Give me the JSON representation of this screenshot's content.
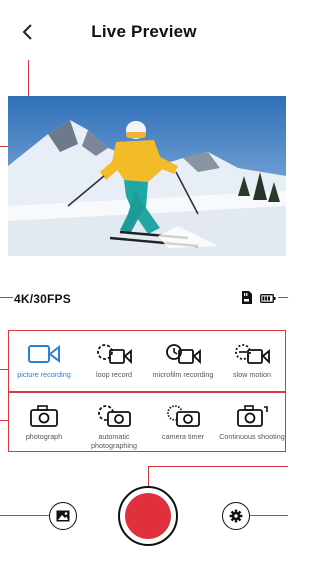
{
  "header": {
    "title": "Live Preview",
    "back_icon": "chevron-left-icon"
  },
  "status": {
    "resolution": "4K/30FPS",
    "storage_icon": "sd-card-icon",
    "battery_icon": "battery-icon"
  },
  "modes": {
    "video": [
      {
        "label": "picture recording",
        "icon": "video-camera-icon",
        "selected": true
      },
      {
        "label": "loop record",
        "icon": "loop-record-icon",
        "selected": false
      },
      {
        "label": "microfilm recording",
        "icon": "microfilm-icon",
        "selected": false
      },
      {
        "label": "slow motion",
        "icon": "slow-motion-icon",
        "selected": false
      }
    ],
    "photo": [
      {
        "label": "photograph",
        "icon": "camera-icon",
        "selected": false
      },
      {
        "label": "automatic photographing",
        "icon": "auto-camera-icon",
        "selected": false
      },
      {
        "label": "camera timer",
        "icon": "timer-camera-icon",
        "selected": false
      },
      {
        "label": "Continuous shooting",
        "icon": "burst-camera-icon",
        "selected": false
      }
    ]
  },
  "controls": {
    "gallery_icon": "gallery-icon",
    "record_icon": "record-icon",
    "settings_icon": "gear-icon"
  },
  "colors": {
    "accent": "#d9363e",
    "record": "#e0303d",
    "selected": "#2d7fd1"
  }
}
